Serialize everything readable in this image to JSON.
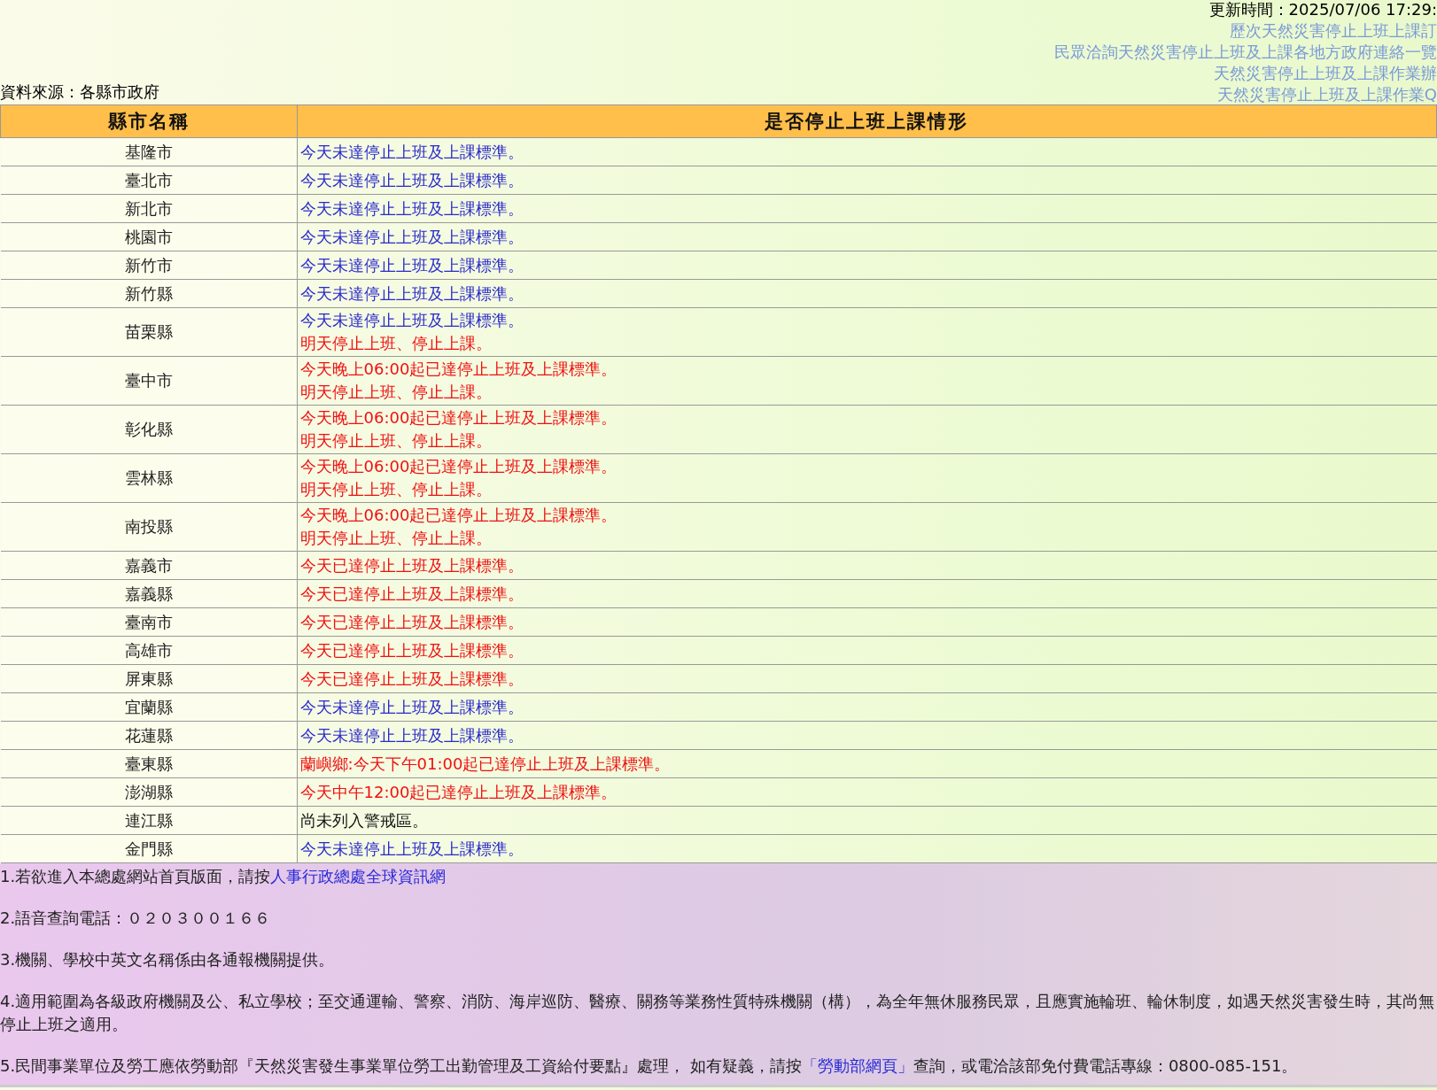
{
  "header": {
    "update_time": "更新時間：2025/07/06 17:29:",
    "links": [
      "歷次天然災害停止上班上課訂",
      "民眾洽詢天然災害停止上班及上課各地方政府連絡一覽",
      "天然災害停止上班及上課作業辦",
      "天然災害停止上班及上課作業Q"
    ],
    "source": "資料來源：各縣市政府"
  },
  "table": {
    "columns": [
      "縣市名稱",
      "是否停止上班上課情形"
    ],
    "rows": [
      {
        "name": "基隆市",
        "lines": [
          {
            "kind": "normal",
            "text": "今天未達停止上班及上課標準。"
          }
        ]
      },
      {
        "name": "臺北市",
        "lines": [
          {
            "kind": "normal",
            "text": "今天未達停止上班及上課標準。"
          }
        ]
      },
      {
        "name": "新北市",
        "lines": [
          {
            "kind": "normal",
            "text": "今天未達停止上班及上課標準。"
          }
        ]
      },
      {
        "name": "桃園市",
        "lines": [
          {
            "kind": "normal",
            "text": "今天未達停止上班及上課標準。"
          }
        ]
      },
      {
        "name": "新竹市",
        "lines": [
          {
            "kind": "normal",
            "text": "今天未達停止上班及上課標準。"
          }
        ]
      },
      {
        "name": "新竹縣",
        "lines": [
          {
            "kind": "normal",
            "text": "今天未達停止上班及上課標準。"
          }
        ]
      },
      {
        "name": "苗栗縣",
        "lines": [
          {
            "kind": "normal",
            "text": "今天未達停止上班及上課標準。"
          },
          {
            "kind": "alert",
            "text": "明天停止上班、停止上課。"
          }
        ]
      },
      {
        "name": "臺中市",
        "lines": [
          {
            "kind": "alert",
            "text": "今天晚上06:00起已達停止上班及上課標準。"
          },
          {
            "kind": "alert",
            "text": "明天停止上班、停止上課。"
          }
        ]
      },
      {
        "name": "彰化縣",
        "lines": [
          {
            "kind": "alert",
            "text": "今天晚上06:00起已達停止上班及上課標準。"
          },
          {
            "kind": "alert",
            "text": "明天停止上班、停止上課。"
          }
        ]
      },
      {
        "name": "雲林縣",
        "lines": [
          {
            "kind": "alert",
            "text": "今天晚上06:00起已達停止上班及上課標準。"
          },
          {
            "kind": "alert",
            "text": "明天停止上班、停止上課。"
          }
        ]
      },
      {
        "name": "南投縣",
        "lines": [
          {
            "kind": "alert",
            "text": "今天晚上06:00起已達停止上班及上課標準。"
          },
          {
            "kind": "alert",
            "text": "明天停止上班、停止上課。"
          }
        ]
      },
      {
        "name": "嘉義市",
        "lines": [
          {
            "kind": "alert",
            "text": "今天已達停止上班及上課標準。"
          }
        ]
      },
      {
        "name": "嘉義縣",
        "lines": [
          {
            "kind": "alert",
            "text": "今天已達停止上班及上課標準。"
          }
        ]
      },
      {
        "name": "臺南市",
        "lines": [
          {
            "kind": "alert",
            "text": "今天已達停止上班及上課標準。"
          }
        ]
      },
      {
        "name": "高雄市",
        "lines": [
          {
            "kind": "alert",
            "text": "今天已達停止上班及上課標準。"
          }
        ]
      },
      {
        "name": "屏東縣",
        "lines": [
          {
            "kind": "alert",
            "text": "今天已達停止上班及上課標準。"
          }
        ]
      },
      {
        "name": "宜蘭縣",
        "lines": [
          {
            "kind": "normal",
            "text": "今天未達停止上班及上課標準。"
          }
        ]
      },
      {
        "name": "花蓮縣",
        "lines": [
          {
            "kind": "normal",
            "text": "今天未達停止上班及上課標準。"
          }
        ]
      },
      {
        "name": "臺東縣",
        "lines": [
          {
            "kind": "alert",
            "text": "蘭嶼鄉:今天下午01:00起已達停止上班及上課標準。"
          }
        ]
      },
      {
        "name": "澎湖縣",
        "lines": [
          {
            "kind": "alert",
            "text": "今天中午12:00起已達停止上班及上課標準。"
          }
        ]
      },
      {
        "name": "連江縣",
        "lines": [
          {
            "kind": "plain",
            "text": "尚未列入警戒區。"
          }
        ]
      },
      {
        "name": "金門縣",
        "lines": [
          {
            "kind": "normal",
            "text": "今天未達停止上班及上課標準。"
          }
        ]
      }
    ]
  },
  "notes": [
    {
      "text": "1.若欲進入本總處網站首頁版面，請按",
      "link": "人事行政總處全球資訊網"
    },
    {
      "text": "2.語音查詢電話：０２０３００１６６"
    },
    {
      "text": "3.機關、學校中英文名稱係由各通報機關提供。"
    },
    {
      "text": "4.適用範圍為各級政府機關及公、私立學校；至交通運輸、警察、消防、海岸巡防、醫療、關務等業務性質特殊機關（構），為全年無休服務民眾，且應實施輪班、輪休制度，如遇天然災害發生時，其尚無停止上班之適用。"
    },
    {
      "text": "5.民間事業單位及勞工應依勞動部『天然災害發生事業單位勞工出勤管理及工資給付要點』處理， 如有疑義，請按",
      "link": "「勞動部網頁」",
      "after": "查詢，或電洽該部免付費電話專線：0800-085-151。"
    }
  ]
}
